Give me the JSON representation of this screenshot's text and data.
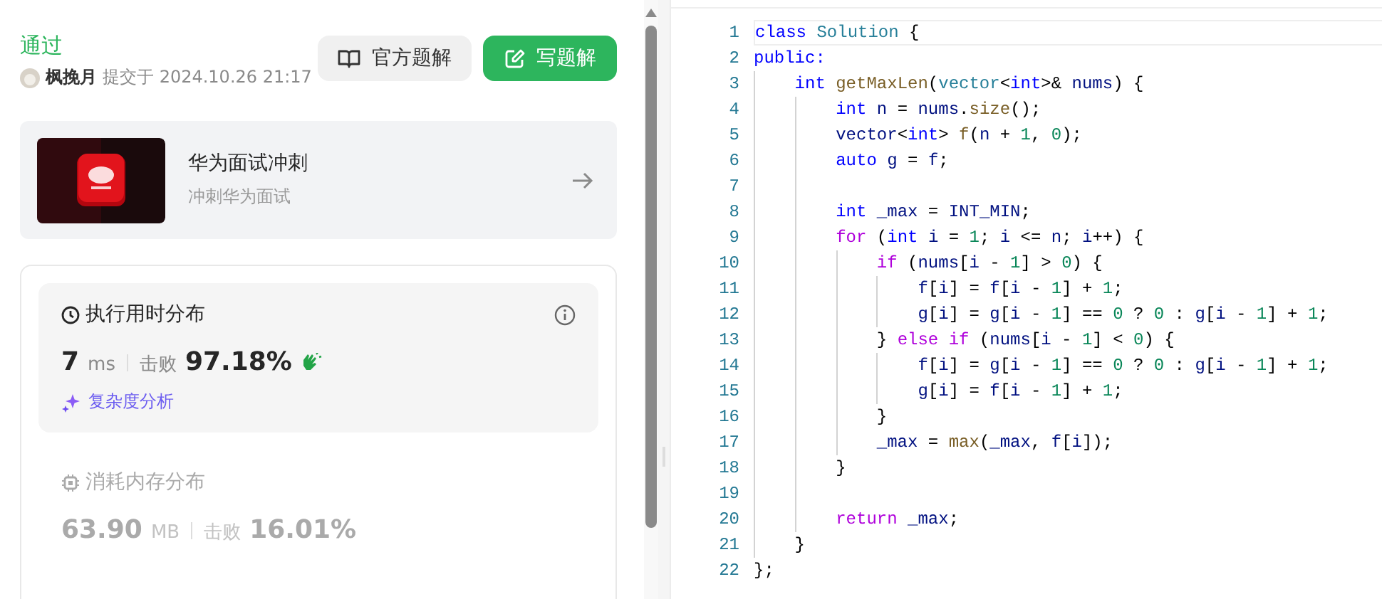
{
  "status": "通过",
  "submission": {
    "author": "枫挽月",
    "submitted_at": "提交于 2024.10.26 21:17"
  },
  "buttons": [
    {
      "label": "官方题解",
      "kind": "secondary"
    },
    {
      "label": "写题解",
      "kind": "primary"
    }
  ],
  "promo": {
    "title": "华为面试冲刺",
    "subtitle": "冲刺华为面试"
  },
  "metrics": [
    {
      "kind": "runtime",
      "title": "执行用时分布",
      "value": "7",
      "unit": "ms",
      "beats_label": "击败",
      "beats": "97.18%",
      "selected": true,
      "link": "复杂度分析"
    },
    {
      "kind": "memory",
      "title": "消耗内存分布",
      "value": "63.90",
      "unit": "MB",
      "beats_label": "击败",
      "beats": "16.01%",
      "selected": false
    }
  ],
  "editor": {
    "lines": [
      {
        "number": "1",
        "kind": "code",
        "tokens": [
          {
            "kind": "keyword",
            "text": "class "
          },
          {
            "kind": "type",
            "text": "Solution"
          },
          {
            "kind": "plain",
            "text": " {"
          }
        ]
      },
      {
        "number": "2",
        "kind": "access",
        "tokens": [
          {
            "kind": "keyword",
            "text": "public:"
          }
        ]
      },
      {
        "number": "3",
        "kind": "code",
        "tokens": [
          {
            "kind": "keyword",
            "text": "int "
          },
          {
            "kind": "function",
            "text": "getMaxLen"
          },
          {
            "kind": "plain",
            "text": "("
          },
          {
            "kind": "type",
            "text": "vector"
          },
          {
            "kind": "plain",
            "text": "<"
          },
          {
            "kind": "keyword",
            "text": "int"
          },
          {
            "kind": "plain",
            "text": ">& "
          },
          {
            "kind": "variable",
            "text": "nums"
          },
          {
            "kind": "plain",
            "text": ") {"
          }
        ]
      },
      {
        "number": "4",
        "kind": "code",
        "tokens": [
          {
            "kind": "keyword",
            "text": "int "
          },
          {
            "kind": "variable",
            "text": "n"
          },
          {
            "kind": "plain",
            "text": " = "
          },
          {
            "kind": "variable",
            "text": "nums"
          },
          {
            "kind": "plain",
            "text": "."
          },
          {
            "kind": "function",
            "text": "size"
          },
          {
            "kind": "plain",
            "text": "();"
          }
        ]
      },
      {
        "number": "5",
        "kind": "code",
        "tokens": [
          {
            "kind": "variable",
            "text": "vector"
          },
          {
            "kind": "plain",
            "text": "<"
          },
          {
            "kind": "keyword",
            "text": "int"
          },
          {
            "kind": "plain",
            "text": "> "
          },
          {
            "kind": "function",
            "text": "f"
          },
          {
            "kind": "plain",
            "text": "("
          },
          {
            "kind": "variable",
            "text": "n"
          },
          {
            "kind": "plain",
            "text": " + "
          },
          {
            "kind": "number",
            "text": "1"
          },
          {
            "kind": "plain",
            "text": ", "
          },
          {
            "kind": "number",
            "text": "0"
          },
          {
            "kind": "plain",
            "text": ");"
          }
        ]
      },
      {
        "number": "6",
        "kind": "code",
        "tokens": [
          {
            "kind": "keyword",
            "text": "auto "
          },
          {
            "kind": "variable",
            "text": "g"
          },
          {
            "kind": "plain",
            "text": " = "
          },
          {
            "kind": "variable",
            "text": "f"
          },
          {
            "kind": "plain",
            "text": ";"
          }
        ]
      },
      {
        "number": "7",
        "kind": "code"
      },
      {
        "number": "8",
        "kind": "code",
        "tokens": [
          {
            "kind": "keyword",
            "text": "int "
          },
          {
            "kind": "variable",
            "text": "_max"
          },
          {
            "kind": "plain",
            "text": " = "
          },
          {
            "kind": "variable",
            "text": "INT_MIN"
          },
          {
            "kind": "plain",
            "text": ";"
          }
        ]
      },
      {
        "number": "9",
        "kind": "code",
        "tokens": [
          {
            "kind": "control",
            "text": "for"
          },
          {
            "kind": "plain",
            "text": " ("
          },
          {
            "kind": "keyword",
            "text": "int "
          },
          {
            "kind": "variable",
            "text": "i"
          },
          {
            "kind": "plain",
            "text": " = "
          },
          {
            "kind": "number",
            "text": "1"
          },
          {
            "kind": "plain",
            "text": "; "
          },
          {
            "kind": "variable",
            "text": "i"
          },
          {
            "kind": "plain",
            "text": " <= "
          },
          {
            "kind": "variable",
            "text": "n"
          },
          {
            "kind": "plain",
            "text": "; "
          },
          {
            "kind": "variable",
            "text": "i"
          },
          {
            "kind": "plain",
            "text": "++) {"
          }
        ]
      },
      {
        "number": "10",
        "kind": "code",
        "tokens": [
          {
            "kind": "control",
            "text": "if"
          },
          {
            "kind": "plain",
            "text": " ("
          },
          {
            "kind": "variable",
            "text": "nums"
          },
          {
            "kind": "plain",
            "text": "["
          },
          {
            "kind": "variable",
            "text": "i"
          },
          {
            "kind": "plain",
            "text": " - "
          },
          {
            "kind": "number",
            "text": "1"
          },
          {
            "kind": "plain",
            "text": "] > "
          },
          {
            "kind": "number",
            "text": "0"
          },
          {
            "kind": "plain",
            "text": ") {"
          }
        ]
      },
      {
        "number": "11",
        "kind": "code",
        "tokens": [
          {
            "kind": "variable",
            "text": "f"
          },
          {
            "kind": "plain",
            "text": "["
          },
          {
            "kind": "variable",
            "text": "i"
          },
          {
            "kind": "plain",
            "text": "] = "
          },
          {
            "kind": "variable",
            "text": "f"
          },
          {
            "kind": "plain",
            "text": "["
          },
          {
            "kind": "variable",
            "text": "i"
          },
          {
            "kind": "plain",
            "text": " - "
          },
          {
            "kind": "number",
            "text": "1"
          },
          {
            "kind": "plain",
            "text": "] + "
          },
          {
            "kind": "number",
            "text": "1"
          },
          {
            "kind": "plain",
            "text": ";"
          }
        ]
      },
      {
        "number": "12",
        "kind": "code",
        "tokens": [
          {
            "kind": "variable",
            "text": "g"
          },
          {
            "kind": "plain",
            "text": "["
          },
          {
            "kind": "variable",
            "text": "i"
          },
          {
            "kind": "plain",
            "text": "] = "
          },
          {
            "kind": "variable",
            "text": "g"
          },
          {
            "kind": "plain",
            "text": "["
          },
          {
            "kind": "variable",
            "text": "i"
          },
          {
            "kind": "plain",
            "text": " - "
          },
          {
            "kind": "number",
            "text": "1"
          },
          {
            "kind": "plain",
            "text": "] == "
          },
          {
            "kind": "number",
            "text": "0"
          },
          {
            "kind": "plain",
            "text": " ? "
          },
          {
            "kind": "number",
            "text": "0"
          },
          {
            "kind": "plain",
            "text": " : "
          },
          {
            "kind": "variable",
            "text": "g"
          },
          {
            "kind": "plain",
            "text": "["
          },
          {
            "kind": "variable",
            "text": "i"
          },
          {
            "kind": "plain",
            "text": " - "
          },
          {
            "kind": "number",
            "text": "1"
          },
          {
            "kind": "plain",
            "text": "] + "
          },
          {
            "kind": "number",
            "text": "1"
          },
          {
            "kind": "plain",
            "text": ";"
          }
        ]
      },
      {
        "number": "13",
        "kind": "code",
        "tokens": [
          {
            "kind": "plain",
            "text": "} "
          },
          {
            "kind": "control",
            "text": "else if"
          },
          {
            "kind": "plain",
            "text": " ("
          },
          {
            "kind": "variable",
            "text": "nums"
          },
          {
            "kind": "plain",
            "text": "["
          },
          {
            "kind": "variable",
            "text": "i"
          },
          {
            "kind": "plain",
            "text": " - "
          },
          {
            "kind": "number",
            "text": "1"
          },
          {
            "kind": "plain",
            "text": "] < "
          },
          {
            "kind": "number",
            "text": "0"
          },
          {
            "kind": "plain",
            "text": ") {"
          }
        ]
      },
      {
        "number": "14",
        "kind": "code",
        "tokens": [
          {
            "kind": "variable",
            "text": "f"
          },
          {
            "kind": "plain",
            "text": "["
          },
          {
            "kind": "variable",
            "text": "i"
          },
          {
            "kind": "plain",
            "text": "] = "
          },
          {
            "kind": "variable",
            "text": "g"
          },
          {
            "kind": "plain",
            "text": "["
          },
          {
            "kind": "variable",
            "text": "i"
          },
          {
            "kind": "plain",
            "text": " - "
          },
          {
            "kind": "number",
            "text": "1"
          },
          {
            "kind": "plain",
            "text": "] == "
          },
          {
            "kind": "number",
            "text": "0"
          },
          {
            "kind": "plain",
            "text": " ? "
          },
          {
            "kind": "number",
            "text": "0"
          },
          {
            "kind": "plain",
            "text": " : "
          },
          {
            "kind": "variable",
            "text": "g"
          },
          {
            "kind": "plain",
            "text": "["
          },
          {
            "kind": "variable",
            "text": "i"
          },
          {
            "kind": "plain",
            "text": " - "
          },
          {
            "kind": "number",
            "text": "1"
          },
          {
            "kind": "plain",
            "text": "] + "
          },
          {
            "kind": "number",
            "text": "1"
          },
          {
            "kind": "plain",
            "text": ";"
          }
        ]
      },
      {
        "number": "15",
        "kind": "code",
        "tokens": [
          {
            "kind": "variable",
            "text": "g"
          },
          {
            "kind": "plain",
            "text": "["
          },
          {
            "kind": "variable",
            "text": "i"
          },
          {
            "kind": "plain",
            "text": "] = "
          },
          {
            "kind": "variable",
            "text": "f"
          },
          {
            "kind": "plain",
            "text": "["
          },
          {
            "kind": "variable",
            "text": "i"
          },
          {
            "kind": "plain",
            "text": " - "
          },
          {
            "kind": "number",
            "text": "1"
          },
          {
            "kind": "plain",
            "text": "] + "
          },
          {
            "kind": "number",
            "text": "1"
          },
          {
            "kind": "plain",
            "text": ";"
          }
        ]
      },
      {
        "number": "16",
        "kind": "code",
        "tokens": [
          {
            "kind": "plain",
            "text": "}"
          }
        ]
      },
      {
        "number": "17",
        "kind": "code",
        "tokens": [
          {
            "kind": "variable",
            "text": "_max"
          },
          {
            "kind": "plain",
            "text": " = "
          },
          {
            "kind": "function",
            "text": "max"
          },
          {
            "kind": "plain",
            "text": "("
          },
          {
            "kind": "variable",
            "text": "_max"
          },
          {
            "kind": "plain",
            "text": ", "
          },
          {
            "kind": "variable",
            "text": "f"
          },
          {
            "kind": "plain",
            "text": "["
          },
          {
            "kind": "variable",
            "text": "i"
          },
          {
            "kind": "plain",
            "text": "]);"
          }
        ]
      },
      {
        "number": "18",
        "kind": "code",
        "tokens": [
          {
            "kind": "plain",
            "text": "}"
          }
        ]
      },
      {
        "number": "19",
        "kind": "code"
      },
      {
        "number": "20",
        "kind": "code",
        "tokens": [
          {
            "kind": "control",
            "text": "return "
          },
          {
            "kind": "variable",
            "text": "_max"
          },
          {
            "kind": "plain",
            "text": ";"
          }
        ]
      },
      {
        "number": "21",
        "kind": "code",
        "tokens": [
          {
            "kind": "plain",
            "text": "}"
          }
        ]
      },
      {
        "number": "22",
        "kind": "code",
        "tokens": [
          {
            "kind": "plain",
            "text": "};"
          }
        ]
      }
    ]
  }
}
